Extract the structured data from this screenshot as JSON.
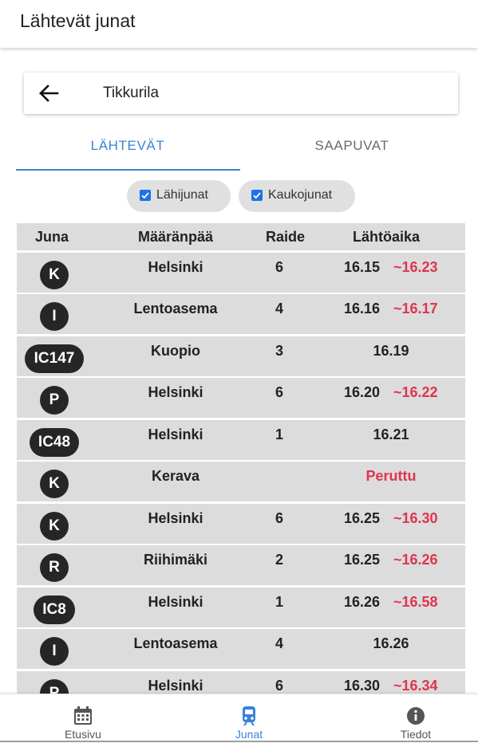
{
  "appbar": {
    "title": "Lähtevät junat"
  },
  "search": {
    "station": "Tikkurila"
  },
  "tabs": [
    {
      "label": "LÄHTEVÄT",
      "active": true
    },
    {
      "label": "SAAPUVAT",
      "active": false
    }
  ],
  "filters": [
    {
      "label": "Lähijunat",
      "checked": true
    },
    {
      "label": "Kaukojunat",
      "checked": true
    }
  ],
  "table": {
    "headers": {
      "train": "Juna",
      "destination": "Määränpää",
      "track": "Raide",
      "departure": "Lähtöaika"
    },
    "rows": [
      {
        "train": "K",
        "destination": "Helsinki",
        "track": "6",
        "scheduled": "16.15",
        "estimate": "~16.23"
      },
      {
        "train": "I",
        "destination": "Lentoasema",
        "track": "4",
        "scheduled": "16.16",
        "estimate": "~16.17"
      },
      {
        "train": "IC147",
        "destination": "Kuopio",
        "track": "3",
        "scheduled": "16.19",
        "estimate": ""
      },
      {
        "train": "P",
        "destination": "Helsinki",
        "track": "6",
        "scheduled": "16.20",
        "estimate": "~16.22"
      },
      {
        "train": "IC48",
        "destination": "Helsinki",
        "track": "1",
        "scheduled": "16.21",
        "estimate": ""
      },
      {
        "train": "K",
        "destination": "Kerava",
        "track": "",
        "scheduled": "",
        "estimate": "",
        "status": "Peruttu"
      },
      {
        "train": "K",
        "destination": "Helsinki",
        "track": "6",
        "scheduled": "16.25",
        "estimate": "~16.30"
      },
      {
        "train": "R",
        "destination": "Riihimäki",
        "track": "2",
        "scheduled": "16.25",
        "estimate": "~16.26"
      },
      {
        "train": "IC8",
        "destination": "Helsinki",
        "track": "1",
        "scheduled": "16.26",
        "estimate": "~16.58"
      },
      {
        "train": "I",
        "destination": "Lentoasema",
        "track": "4",
        "scheduled": "16.26",
        "estimate": ""
      },
      {
        "train": "P",
        "destination": "Helsinki",
        "track": "6",
        "scheduled": "16.30",
        "estimate": "~16.34"
      }
    ]
  },
  "bottom_nav": [
    {
      "label": "Etusivu",
      "icon": "calendar-icon",
      "active": false
    },
    {
      "label": "Junat",
      "icon": "train-icon",
      "active": true
    },
    {
      "label": "Tiedot",
      "icon": "info-icon",
      "active": false
    }
  ],
  "colors": {
    "accent": "#3b82d6",
    "delay": "#e0344d",
    "badge": "#262626",
    "row": "#dcdcdc"
  }
}
